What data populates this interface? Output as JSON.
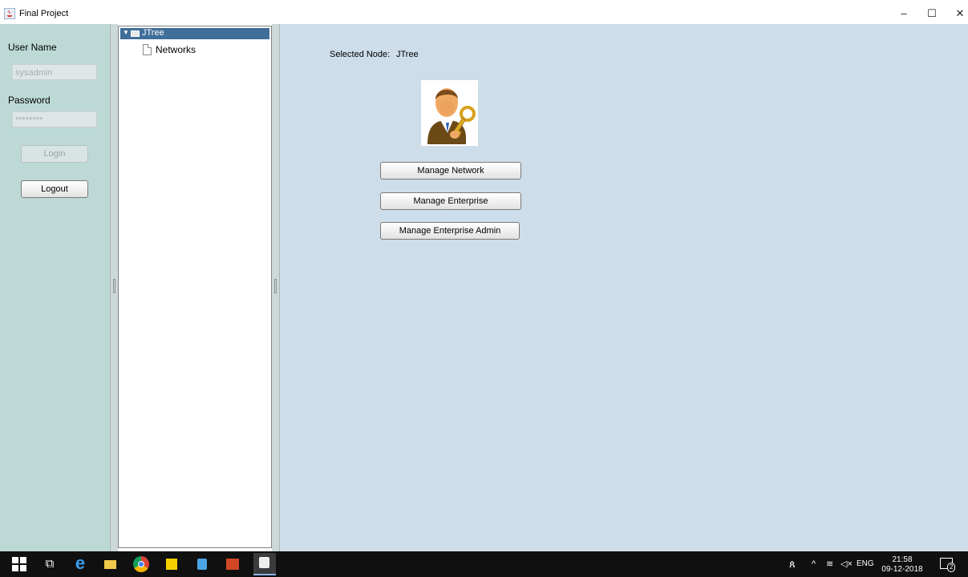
{
  "window": {
    "title": "Final Project",
    "controls": {
      "minimize": "–",
      "maximize": "☐",
      "close": "✕"
    }
  },
  "login_panel": {
    "username_label": "User Name",
    "username_value": "sysadmin",
    "password_label": "Password",
    "password_value": "********",
    "login_label": "Login",
    "logout_label": "Logout",
    "background_color": "#bdd9d6"
  },
  "tree": {
    "root_label": "JTree",
    "root_expanded_glyph": "▼",
    "children": [
      {
        "label": "Networks"
      }
    ],
    "selection_color": "#3f6e99"
  },
  "main": {
    "selected_node_label": "Selected Node:",
    "selected_node_value": "JTree",
    "image_icon": "admin-key-icon",
    "buttons": {
      "manage_network": "Manage Network",
      "manage_enterprise": "Manage Enterprise",
      "manage_enterprise_admin": "Manage Enterprise Admin"
    },
    "background_color": "#cddde9"
  },
  "taskbar": {
    "apps": [
      "windows-start-icon",
      "task-view-icon",
      "edge-icon",
      "file-explorer-icon",
      "chrome-icon",
      "sticky-notes-icon",
      "box-app-icon",
      "office-icon",
      "java-icon"
    ],
    "tray": {
      "people": "ጰ",
      "chevron": "^",
      "network": "≋",
      "volume": "◁×",
      "language": "ENG",
      "time": "21:58",
      "date": "09-12-2018",
      "notification_count": "2"
    }
  }
}
